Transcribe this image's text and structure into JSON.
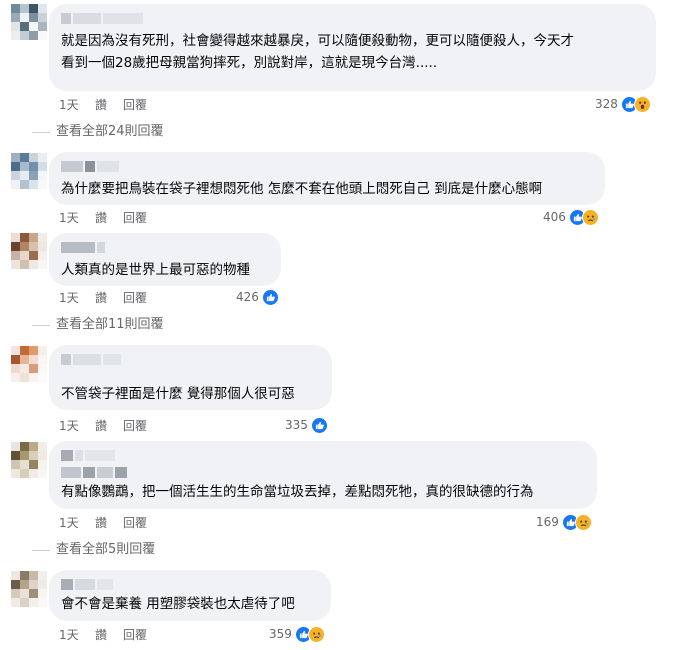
{
  "comments": [
    {
      "text": "就是因為沒有死刑，社會變得越來越暴戾，可以隨便殺動物，更可以隨便殺人，今天才\n看到一個28歲把母親當狗摔死，別說對岸，這就是現今台灣.....",
      "time": "1天",
      "like": "讚",
      "reply": "回覆",
      "reaction_count": "328",
      "reactions": [
        "like",
        "wow"
      ],
      "view_replies": "查看全部24則回覆"
    },
    {
      "text": "為什麼要把鳥裝在袋子裡想悶死他 怎麼不套在他頭上悶死自己 到底是什麼心態啊",
      "time": "1天",
      "like": "讚",
      "reply": "回覆",
      "reaction_count": "406",
      "reactions": [
        "like",
        "sad"
      ]
    },
    {
      "text": "人類真的是世界上最可惡的物種",
      "time": "1天",
      "like": "讚",
      "reply": "回覆",
      "reaction_count": "426",
      "reactions": [
        "like"
      ],
      "view_replies": "查看全部11則回覆"
    },
    {
      "text": "不管袋子裡面是什麼 覺得那個人很可惡",
      "time": "1天",
      "like": "讚",
      "reply": "回覆",
      "reaction_count": "335",
      "reactions": [
        "like"
      ]
    },
    {
      "text": "有點像鸚鵡，把一個活生生的生命當垃圾丟掉，差點悶死牠，真的很缺德的行為",
      "time": "1天",
      "like": "讚",
      "reply": "回覆",
      "reaction_count": "169",
      "reactions": [
        "like",
        "sad"
      ],
      "view_replies": "查看全部5則回覆"
    },
    {
      "text": "會不會是棄養 用塑膠袋裝也太虐待了吧",
      "time": "1天",
      "like": "讚",
      "reply": "回覆",
      "reaction_count": "359",
      "reactions": [
        "like",
        "sad"
      ]
    }
  ],
  "colors": {
    "bubble": "#f0f2f5",
    "secondary_text": "#65676b",
    "like_blue": "#1877f2",
    "sad_yellow": "#f7b125"
  }
}
